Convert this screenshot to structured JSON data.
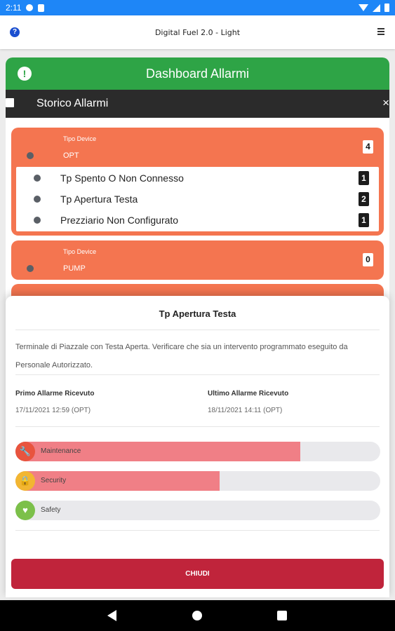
{
  "status_bar": {
    "time": "2:11"
  },
  "app_bar": {
    "title": "Digital Fuel 2.0 - Light",
    "help_glyph": "?"
  },
  "dashboard": {
    "title": "Dashboard Allarmi",
    "alert_glyph": "!"
  },
  "history": {
    "title": "Storico Allarmi",
    "close_glyph": "×"
  },
  "devices": [
    {
      "type_label": "Tipo Device",
      "name": "OPT",
      "count": "4",
      "alarms": [
        {
          "label": "Tp Spento O Non Connesso",
          "count": "1"
        },
        {
          "label": "Tp Apertura Testa",
          "count": "2"
        },
        {
          "label": "Prezziario Non Configurato",
          "count": "1"
        }
      ]
    },
    {
      "type_label": "Tipo Device",
      "name": "PUMP",
      "count": "0"
    }
  ],
  "sheet": {
    "title": "Tp Apertura Testa",
    "description": "Terminale di Piazzale con Testa Aperta. Verificare che sia un intervento programmato eseguito da Personale Autorizzato.",
    "first_alarm_label": "Primo Allarme Ricevuto",
    "first_alarm_value": "17/11/2021 12:59 (OPT)",
    "last_alarm_label": "Ultimo Allarme Ricevuto",
    "last_alarm_value": "18/11/2021 14:11 (OPT)",
    "impacts": [
      {
        "label": "Maintenance",
        "level": 0.78,
        "icon": "wrench-icon",
        "glyph": "🔧",
        "color": "#e8543e"
      },
      {
        "label": "Security",
        "level": 0.56,
        "icon": "lock-icon",
        "glyph": "🔒",
        "color": "#f2b632"
      },
      {
        "label": "Safety",
        "level": 0.0,
        "icon": "heart-icon",
        "glyph": "♥",
        "color": "#7cc04a"
      }
    ],
    "close_label": "CHIUDI"
  }
}
